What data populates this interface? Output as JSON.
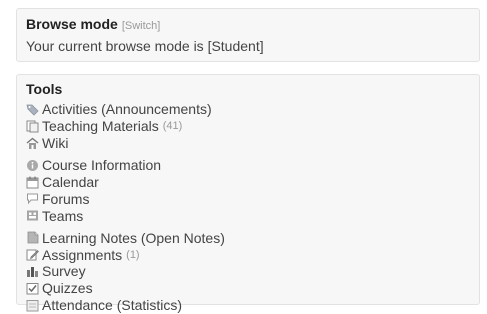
{
  "browse_mode": {
    "title": "Browse mode",
    "switch_label": "[Switch]",
    "mode_text": "Your current browse mode is [Student]"
  },
  "tools": {
    "title": "Tools",
    "items": [
      {
        "label": "Activities (Announcements)",
        "icon": "tag-icon",
        "count": ""
      },
      {
        "label": "Teaching Materials",
        "icon": "folder-icon",
        "count": "(41)"
      },
      {
        "label": "Wiki",
        "icon": "wiki-icon",
        "count": ""
      },
      {
        "label": "Course Information",
        "icon": "info-icon",
        "count": ""
      },
      {
        "label": "Calendar",
        "icon": "calendar-icon",
        "count": ""
      },
      {
        "label": "Forums",
        "icon": "speech-bubble-icon",
        "count": ""
      },
      {
        "label": "Teams",
        "icon": "teams-icon",
        "count": ""
      },
      {
        "label": "Learning Notes (Open Notes)",
        "icon": "note-icon",
        "count": ""
      },
      {
        "label": "Assignments",
        "icon": "assignment-icon",
        "count": "(1)"
      },
      {
        "label": "Survey",
        "icon": "survey-chart-icon",
        "count": ""
      },
      {
        "label": "Quizzes",
        "icon": "quiz-icon",
        "count": ""
      },
      {
        "label": "Attendance (Statistics)",
        "icon": "attendance-icon",
        "count": ""
      }
    ]
  }
}
